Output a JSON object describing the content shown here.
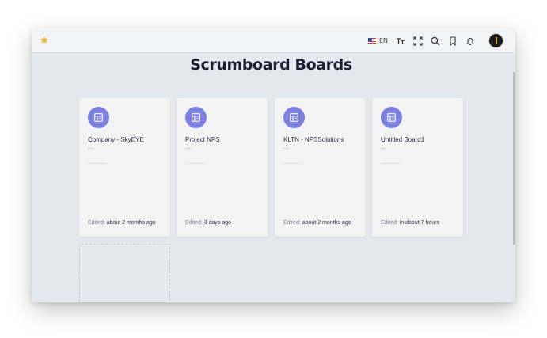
{
  "topbar": {
    "favorite_icon": "star-icon",
    "language_code": "EN",
    "icons": [
      "flag-us-icon",
      "text-size-icon",
      "fullscreen-icon",
      "search-icon",
      "bookmark-icon",
      "bell-icon",
      "avatar"
    ]
  },
  "page": {
    "title": "Scrumboard Boards"
  },
  "boards": [
    {
      "title": "Company - SkyEYE",
      "description": "...",
      "edited_label": "Edited:",
      "edited_value": "about 2 months ago"
    },
    {
      "title": "Project NPS",
      "description": "...",
      "edited_label": "Edited:",
      "edited_value": "3 days ago"
    },
    {
      "title": "KLTN - NPSSolutions",
      "description": "...",
      "edited_label": "Edited:",
      "edited_value": "about 2 months ago"
    },
    {
      "title": "Untitled Board1",
      "description": "...",
      "edited_label": "Edited:",
      "edited_value": "in about 7 hours"
    }
  ],
  "colors": {
    "accent": "#7b7fe0",
    "favorite": "#f5a524",
    "background": "#e4e7ec"
  }
}
